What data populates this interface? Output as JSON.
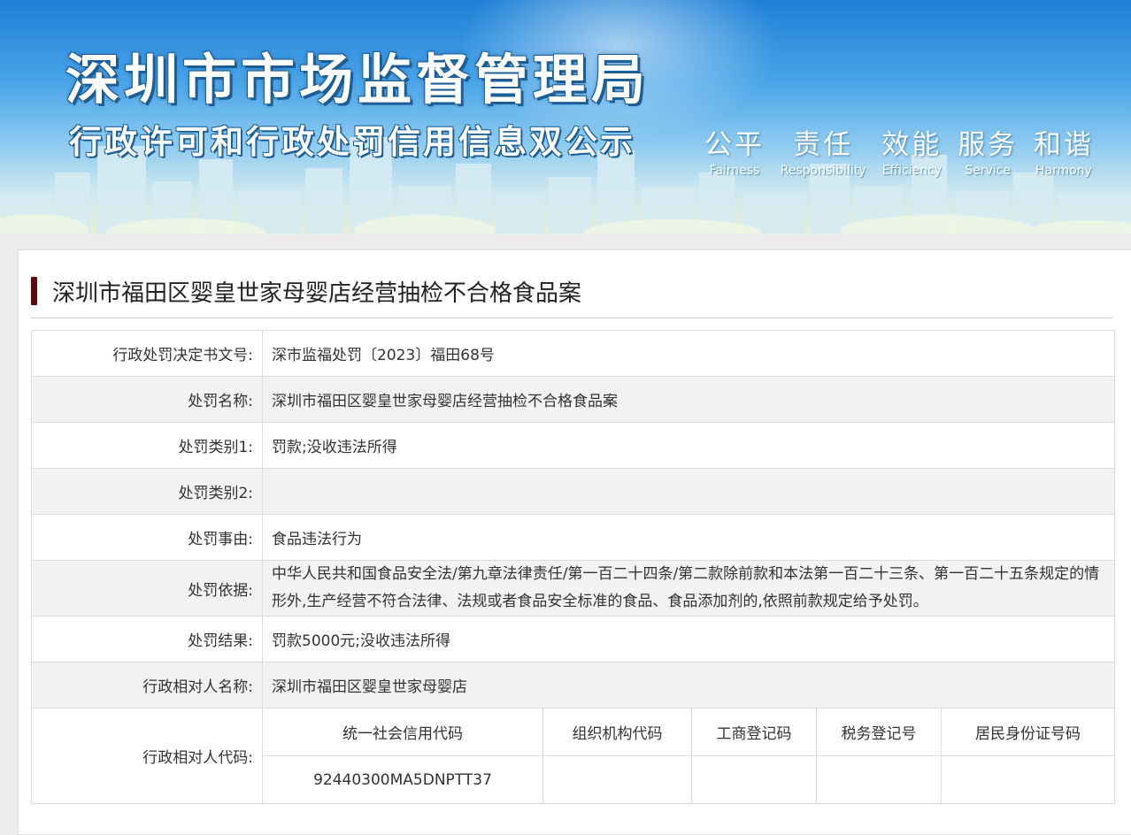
{
  "banner": {
    "title_main": "深圳市市场监督管理局",
    "title_sub": "行政许可和行政处罚信用信息双公示",
    "values": [
      {
        "zh": "公平",
        "en": "Fairness"
      },
      {
        "zh": "责任",
        "en": "Responsibility"
      },
      {
        "zh": "效能",
        "en": "Efficiency"
      },
      {
        "zh": "服务",
        "en": "Service"
      },
      {
        "zh": "和谐",
        "en": "Harmony"
      }
    ]
  },
  "page": {
    "title": "深圳市福田区婴皇世家母婴店经营抽检不合格食品案"
  },
  "fields": {
    "decision_no": {
      "label": "行政处罚决定书文号:",
      "value": "深市监福处罚〔2023〕福田68号"
    },
    "penalty_name": {
      "label": "处罚名称:",
      "value": "深圳市福田区婴皇世家母婴店经营抽检不合格食品案"
    },
    "category1": {
      "label": "处罚类别1:",
      "value": "罚款;没收违法所得"
    },
    "category2": {
      "label": "处罚类别2:",
      "value": ""
    },
    "reason": {
      "label": "处罚事由:",
      "value": "食品违法行为"
    },
    "basis": {
      "label": "处罚依据:",
      "value": "中华人民共和国食品安全法/第九章法律责任/第一百二十四条/第二款除前款和本法第一百二十三条、第一百二十五条规定的情形外,生产经营不符合法律、法规或者食品安全标准的食品、食品添加剂的,依照前款规定给予处罚。"
    },
    "result": {
      "label": "处罚结果:",
      "value": "罚款5000元;没收违法所得"
    },
    "party_name": {
      "label": "行政相对人名称:",
      "value": "深圳市福田区婴皇世家母婴店"
    },
    "party_code": {
      "label": "行政相对人代码:",
      "headers": [
        "统一社会信用代码",
        "组织机构代码",
        "工商登记码",
        "税务登记号",
        "居民身份证号码"
      ],
      "values": [
        "92440300MA5DNPTT37",
        "",
        "",
        "",
        ""
      ]
    }
  }
}
